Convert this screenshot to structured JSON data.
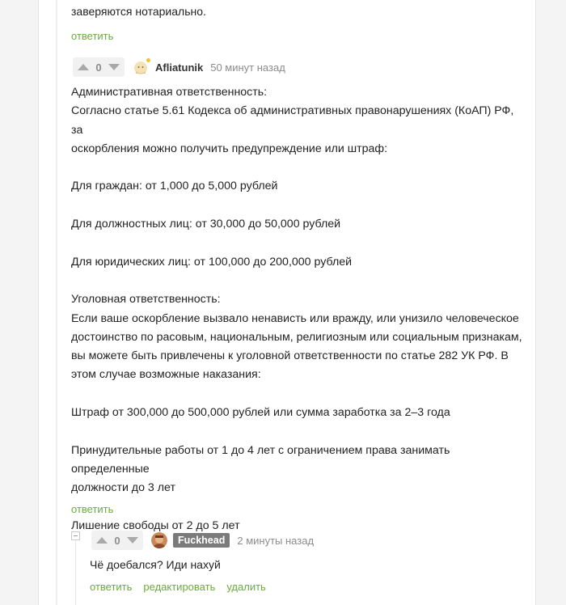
{
  "prev_comment": {
    "text_tail": "заверяются нотариально.",
    "reply_label": "ответить"
  },
  "comment1": {
    "score": "0",
    "author": "Afliatunik",
    "time": "50 минут назад",
    "paragraphs": [
      [
        "Административная ответственность:",
        "Согласно статье 5.61 Кодекса об административных правонарушениях (КоАП) РФ, за",
        "оскорбления можно получить предупреждение или штраф:"
      ],
      [
        "Для граждан: от 1,000 до 5,000 рублей"
      ],
      [
        "Для должностных лиц: от 30,000 до 50,000 рублей"
      ],
      [
        "Для юридических лиц: от 100,000 до 200,000 рублей"
      ],
      [
        "Уголовная ответственность:",
        "Если ваше оскорбление вызвало ненависть или вражду, или унизило человеческое",
        "достоинство по расовым, национальным, религиозным или социальным признакам,",
        "вы можете быть привлечены к уголовной ответственности по статье 282 УК РФ. В",
        "этом случае возможные наказания:"
      ],
      [
        "Штраф от 300,000 до 500,000 рублей или сумма заработка за 2–3 года"
      ],
      [
        "Принудительные работы от 1 до 4 лет с ограничением права занимать определенные",
        "должности до 3 лет"
      ],
      [
        "Лишение свободы от 2 до 5 лет"
      ]
    ],
    "reply_label": "ответить"
  },
  "comment2": {
    "score": "0",
    "author": "Fuckhead",
    "time": "2 минуты назад",
    "text": "Чё доебался? Иди нахуй",
    "actions": {
      "reply": "ответить",
      "edit": "редактировать",
      "delete": "удалить"
    }
  },
  "colors": {
    "link_green": "#6bab3a",
    "muted": "#8c8c8c",
    "author_badge_bg": "#7a7a7a"
  }
}
